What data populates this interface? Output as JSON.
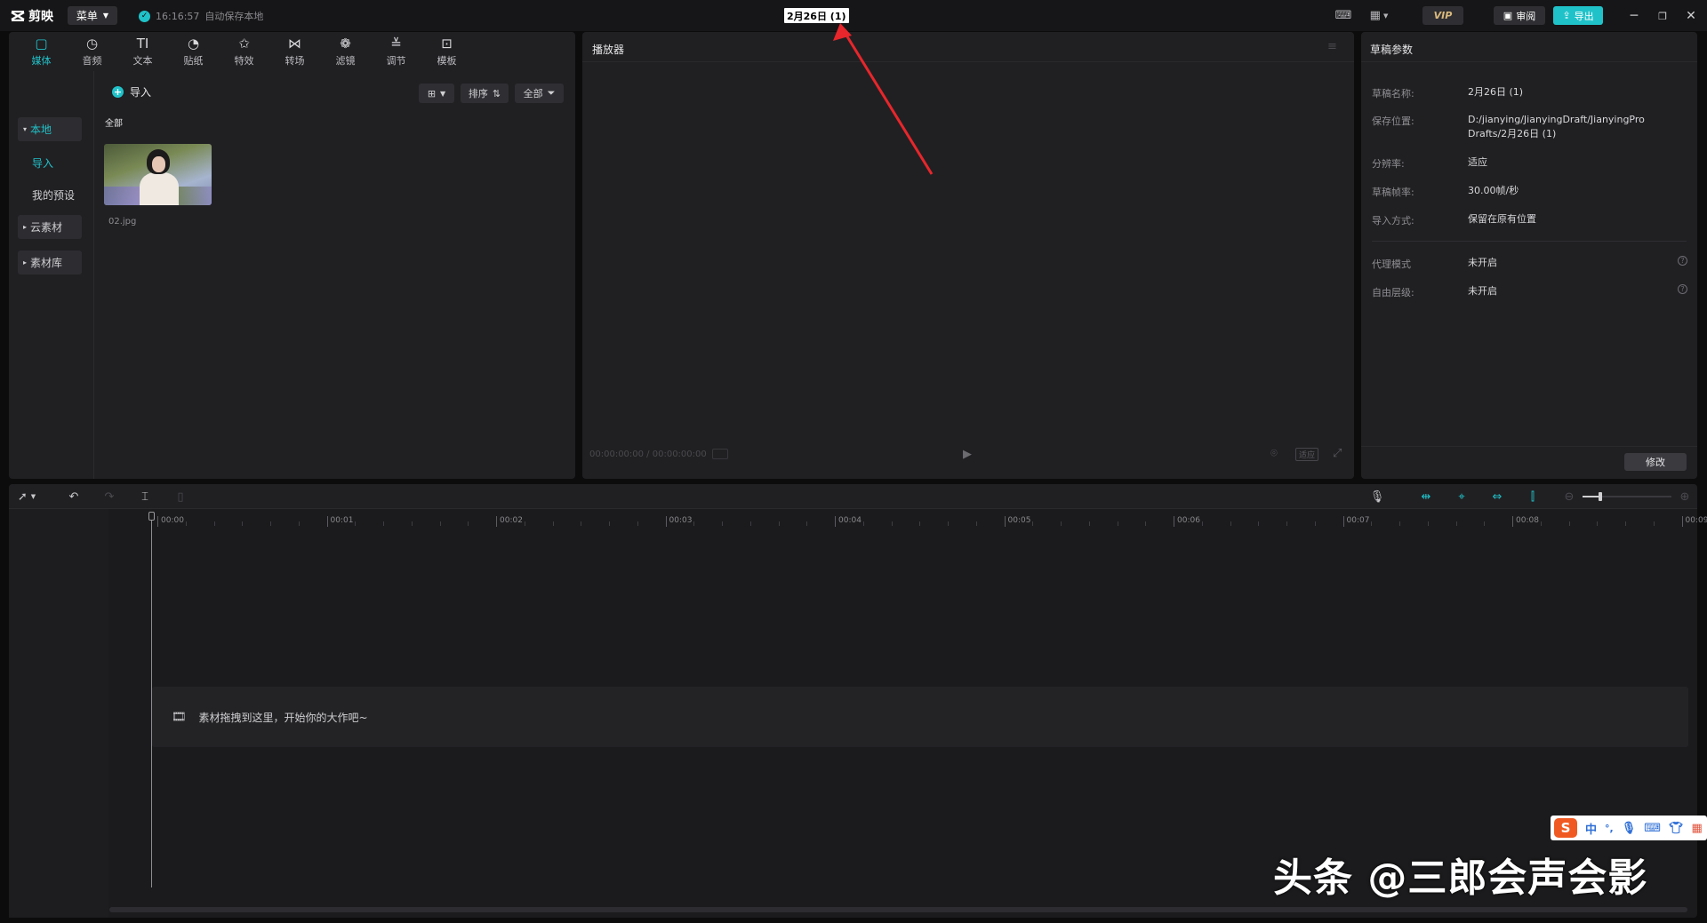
{
  "titlebar": {
    "app_name": "剪映",
    "menu_label": "菜单",
    "save_time": "16:16:57",
    "save_text": "自动保存本地",
    "doc_title": "2月26日 (1)",
    "vip_label": "VIP",
    "review_label": "审阅",
    "export_label": "导出"
  },
  "media_tabs": [
    {
      "label": "媒体",
      "icon": "media-icon",
      "glyph": "▢"
    },
    {
      "label": "音频",
      "icon": "audio-icon",
      "glyph": "◷"
    },
    {
      "label": "文本",
      "icon": "text-icon",
      "glyph": "TI"
    },
    {
      "label": "贴纸",
      "icon": "sticker-icon",
      "glyph": "◔"
    },
    {
      "label": "特效",
      "icon": "effects-icon",
      "glyph": "✩"
    },
    {
      "label": "转场",
      "icon": "transition-icon",
      "glyph": "⋈"
    },
    {
      "label": "滤镜",
      "icon": "filter-icon",
      "glyph": "❁"
    },
    {
      "label": "调节",
      "icon": "adjust-icon",
      "glyph": "≚"
    },
    {
      "label": "模板",
      "icon": "template-icon",
      "glyph": "⊡"
    }
  ],
  "media_sidebar": {
    "local": "本地",
    "import": "导入",
    "presets": "我的预设",
    "cloud": "云素材",
    "library": "素材库"
  },
  "media_main": {
    "import_label": "导入",
    "sort_label": "排序",
    "filter_label": "全部",
    "section_label": "全部",
    "files": [
      {
        "name": "02.jpg"
      }
    ]
  },
  "player": {
    "title": "播放器",
    "timecode": "00:00:00:00 / 00:00:00:00",
    "ratio_label": "适应"
  },
  "draft": {
    "title": "草稿参数",
    "rows": [
      {
        "key": "草稿名称:",
        "value": "2月26日 (1)"
      },
      {
        "key": "保存位置:",
        "value": "D:/jianying/JianyingDraft/JianyingPro Drafts/2月26日 (1)"
      },
      {
        "key": "分辨率:",
        "value": "适应"
      },
      {
        "key": "草稿帧率:",
        "value": "30.00帧/秒"
      },
      {
        "key": "导入方式:",
        "value": "保留在原有位置"
      },
      {
        "key": "代理模式",
        "value": "未开启"
      },
      {
        "key": "自由层级:",
        "value": "未开启"
      }
    ],
    "modify_label": "修改"
  },
  "timeline": {
    "ticks": [
      "00:00",
      "00:01",
      "00:02",
      "00:03",
      "00:04",
      "00:05",
      "00:06",
      "00:07",
      "00:08",
      "00:09"
    ],
    "drop_hint": "素材拖拽到这里，开始你的大作吧~"
  },
  "ime": {
    "lang": "中",
    "punct": "°,"
  },
  "watermark": "头条 @三郎会声会影",
  "colors": {
    "accent": "#20c2c9",
    "annotation_arrow": "#e8262b"
  }
}
